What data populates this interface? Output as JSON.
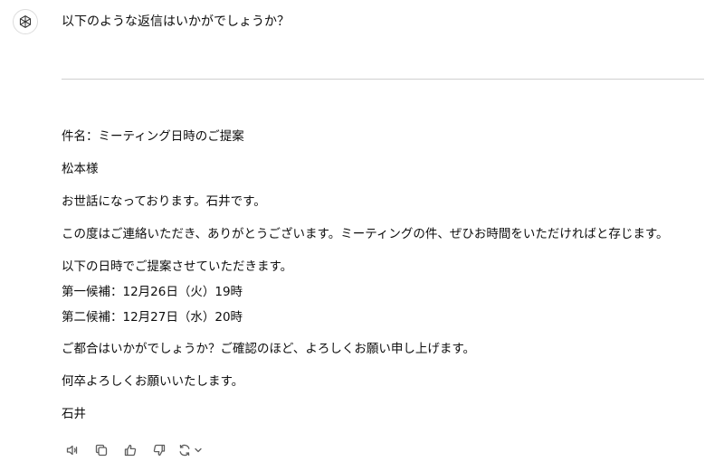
{
  "conversation": {
    "assistant_intro": "以下のような返信はいかがでしょうか？",
    "email": {
      "subject": "件名：ミーティング日時のご提案",
      "salutation": "松本様",
      "greeting": "お世話になっております。石井です。",
      "para1": "この度はご連絡いただき、ありがとうございます。ミーティングの件、ぜひお時間をいただければと存じます。",
      "proposal_intro": "以下の日時でご提案させていただきます。",
      "option1": "第一候補：12月26日（火）19時",
      "option2": "第二候補：12月27日（水）20時",
      "closing_question": "ご都合はいかがでしょうか？ご確認のほど、よろしくお願い申し上げます。",
      "closing": "何卒よろしくお願いいたします。",
      "signature": "石井"
    }
  },
  "icons": {
    "avatar": "openai-logo-icon",
    "read_aloud": "speaker-icon",
    "copy": "copy-icon",
    "thumbs_up": "thumbs-up-icon",
    "thumbs_down": "thumbs-down-icon",
    "regenerate": "regenerate-icon",
    "regenerate_menu": "chevron-down-icon"
  },
  "colors": {
    "text": "#0d0d0d",
    "icon": "#5d5d5d",
    "divider": "#d0d0d0"
  }
}
